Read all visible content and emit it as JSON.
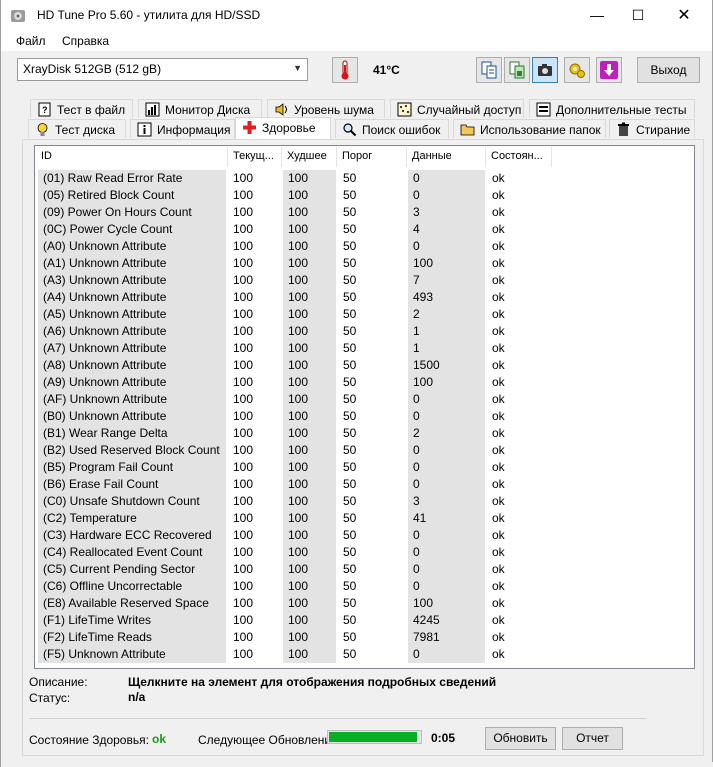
{
  "window": {
    "title": "HD Tune Pro 5.60 - утилита для HD/SSD",
    "minimize": "—",
    "maximize": "☐",
    "close": "✕"
  },
  "menu": {
    "file": "Файл",
    "help": "Справка"
  },
  "toolbar": {
    "drive": "XrayDisk 512GB (512 gB)",
    "temperature": "41°C",
    "exit_label": "Выход",
    "icons": [
      "thermometer-icon",
      "copy-text-icon",
      "copy-image-icon",
      "camera-icon",
      "options-icon",
      "save-icon"
    ]
  },
  "tabs_row1": [
    {
      "label": "Тест в файл",
      "icon": "file-test-icon"
    },
    {
      "label": "Монитор Диска",
      "icon": "disk-monitor-icon"
    },
    {
      "label": "Уровень шума",
      "icon": "speaker-icon"
    },
    {
      "label": "Случайный доступ",
      "icon": "random-access-icon"
    },
    {
      "label": "Дополнительные  тесты",
      "icon": "extra-tests-icon"
    }
  ],
  "tabs_row2": [
    {
      "label": "Тест диска",
      "icon": "benchmark-icon"
    },
    {
      "label": "Информация",
      "icon": "info-icon"
    },
    {
      "label": "Здоровье",
      "icon": "health-icon"
    },
    {
      "label": "Поиск ошибок",
      "icon": "error-scan-icon"
    },
    {
      "label": "Использование папок",
      "icon": "folder-icon"
    },
    {
      "label": "Стирание",
      "icon": "erase-icon"
    }
  ],
  "table": {
    "headers": [
      "ID",
      "Текущ...",
      "Худшее",
      "Порог",
      "Данные",
      "Состоян..."
    ],
    "rows": [
      [
        "(01) Raw Read Error Rate",
        "100",
        "100",
        "50",
        "0",
        "ok"
      ],
      [
        "(05) Retired Block Count",
        "100",
        "100",
        "50",
        "0",
        "ok"
      ],
      [
        "(09) Power On Hours Count",
        "100",
        "100",
        "50",
        "3",
        "ok"
      ],
      [
        "(0C) Power Cycle Count",
        "100",
        "100",
        "50",
        "4",
        "ok"
      ],
      [
        "(A0) Unknown Attribute",
        "100",
        "100",
        "50",
        "0",
        "ok"
      ],
      [
        "(A1) Unknown Attribute",
        "100",
        "100",
        "50",
        "100",
        "ok"
      ],
      [
        "(A3) Unknown Attribute",
        "100",
        "100",
        "50",
        "7",
        "ok"
      ],
      [
        "(A4) Unknown Attribute",
        "100",
        "100",
        "50",
        "493",
        "ok"
      ],
      [
        "(A5) Unknown Attribute",
        "100",
        "100",
        "50",
        "2",
        "ok"
      ],
      [
        "(A6) Unknown Attribute",
        "100",
        "100",
        "50",
        "1",
        "ok"
      ],
      [
        "(A7) Unknown Attribute",
        "100",
        "100",
        "50",
        "1",
        "ok"
      ],
      [
        "(A8) Unknown Attribute",
        "100",
        "100",
        "50",
        "1500",
        "ok"
      ],
      [
        "(A9) Unknown Attribute",
        "100",
        "100",
        "50",
        "100",
        "ok"
      ],
      [
        "(AF) Unknown Attribute",
        "100",
        "100",
        "50",
        "0",
        "ok"
      ],
      [
        "(B0) Unknown Attribute",
        "100",
        "100",
        "50",
        "0",
        "ok"
      ],
      [
        "(B1) Wear Range Delta",
        "100",
        "100",
        "50",
        "2",
        "ok"
      ],
      [
        "(B2) Used Reserved Block Count",
        "100",
        "100",
        "50",
        "0",
        "ok"
      ],
      [
        "(B5) Program Fail Count",
        "100",
        "100",
        "50",
        "0",
        "ok"
      ],
      [
        "(B6) Erase Fail Count",
        "100",
        "100",
        "50",
        "0",
        "ok"
      ],
      [
        "(C0) Unsafe Shutdown Count",
        "100",
        "100",
        "50",
        "3",
        "ok"
      ],
      [
        "(C2) Temperature",
        "100",
        "100",
        "50",
        "41",
        "ok"
      ],
      [
        "(C3) Hardware ECC Recovered",
        "100",
        "100",
        "50",
        "0",
        "ok"
      ],
      [
        "(C4) Reallocated Event Count",
        "100",
        "100",
        "50",
        "0",
        "ok"
      ],
      [
        "(C5) Current Pending Sector",
        "100",
        "100",
        "50",
        "0",
        "ok"
      ],
      [
        "(C6) Offline Uncorrectable",
        "100",
        "100",
        "50",
        "0",
        "ok"
      ],
      [
        "(E8) Available Reserved Space",
        "100",
        "100",
        "50",
        "100",
        "ok"
      ],
      [
        "(F1) LifeTime Writes",
        "100",
        "100",
        "50",
        "4245",
        "ok"
      ],
      [
        "(F2) LifeTime Reads",
        "100",
        "100",
        "50",
        "7981",
        "ok"
      ],
      [
        "(F5) Unknown Attribute",
        "100",
        "100",
        "50",
        "0",
        "ok"
      ]
    ]
  },
  "footer": {
    "description_label": "Описание:",
    "description_text": "Щелкните на элемент для отображения подробных сведений",
    "status_label": "Статус:",
    "status_text": "n/a",
    "health_label": "Состояние Здоровья:",
    "health_value": "ok",
    "next_update_label": "Следующее Обновление:",
    "progress_fraction": 0.97,
    "timer": "0:05",
    "refresh_label": "Обновить",
    "report_label": "Отчет"
  },
  "colors": {
    "ok_green": "#1a9a1a",
    "progress_green": "#06b025"
  }
}
